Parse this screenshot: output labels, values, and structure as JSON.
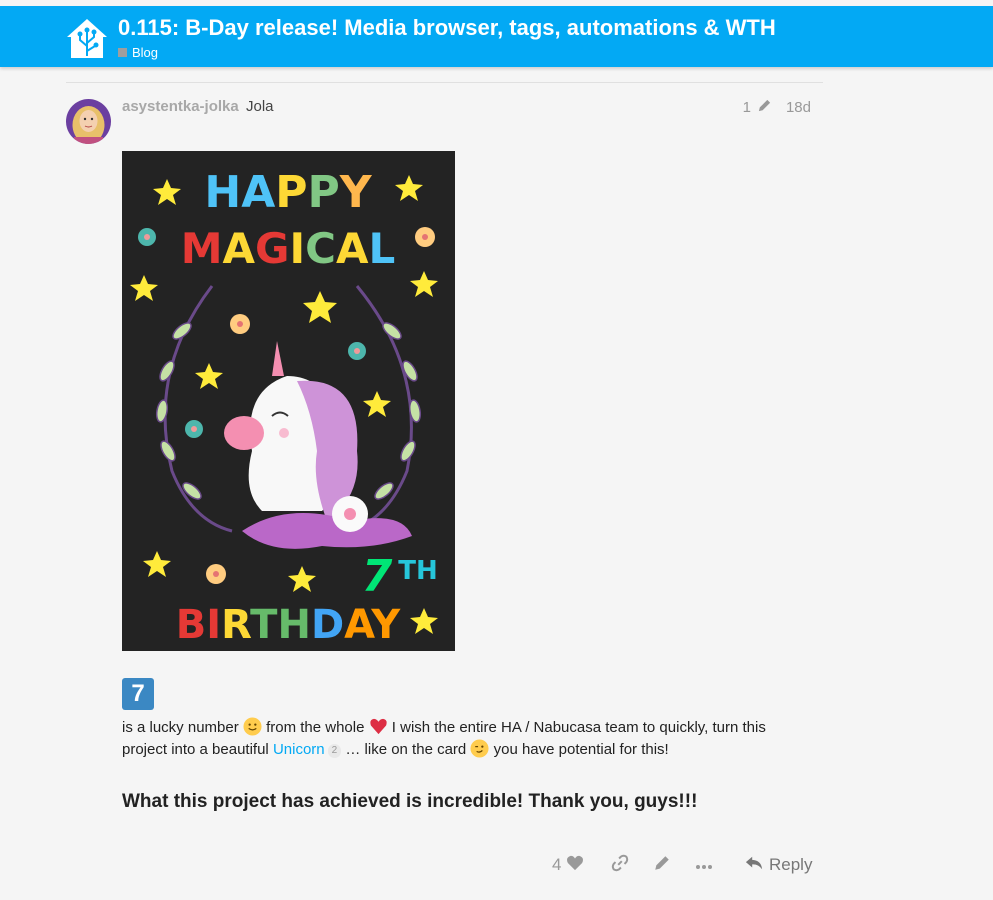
{
  "header": {
    "title": "0.115: B-Day release! Media browser, tags, automations & WTH",
    "category": "Blog"
  },
  "post": {
    "username": "asystentka-jolka",
    "full_name": "Jola",
    "edit_count": "1",
    "age": "18d",
    "poster_lines": [
      "HAPPY",
      "MAGICAL",
      "7",
      "TH",
      "BIRTHDAY"
    ],
    "keycap": "7",
    "text": {
      "p1": "is a lucky number",
      "p2": "from the whole",
      "p3": "I wish the entire HA / Nabucasa team to quickly, turn this project into a beautiful",
      "link": "Unicorn",
      "link_count": "2",
      "p4": "… like on the card",
      "p5": "you have potential for this!"
    },
    "bold_line": "What this project has achieved is incredible! Thank you, guys!!!",
    "actions": {
      "like_count": "4",
      "reply_label": "Reply"
    }
  },
  "colors": {
    "header_bg": "#03a9f4",
    "link": "#03a9f4",
    "keycap": "#3b88c3"
  }
}
